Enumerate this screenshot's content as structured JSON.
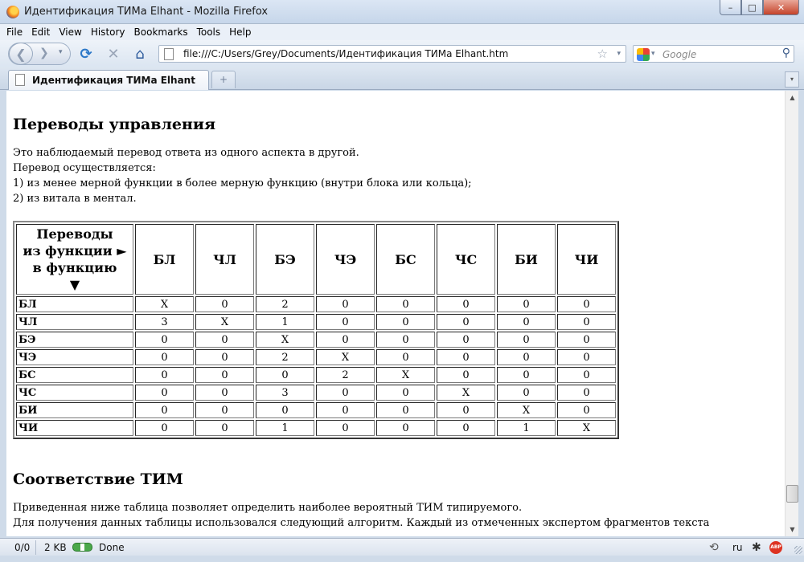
{
  "window": {
    "title": "Идентификация ТИМа Elhant - Mozilla Firefox",
    "minimize_label": "–",
    "maximize_label": "□",
    "close_label": "✕"
  },
  "menu": {
    "items": [
      "File",
      "Edit",
      "View",
      "History",
      "Bookmarks",
      "Tools",
      "Help"
    ]
  },
  "toolbar": {
    "back_glyph": "❮",
    "forward_glyph": "❯",
    "dropdown_glyph": "▾",
    "reload_glyph": "⟳",
    "stop_glyph": "✕",
    "home_glyph": "⌂",
    "url": "file:///C:/Users/Grey/Documents/Идентификация ТИМа Elhant.htm",
    "bookmark_glyph": "☆",
    "search_placeholder": "Google",
    "search_glyph": "⚲"
  },
  "tabs": {
    "active_label": "Идентификация ТИМа Elhant",
    "new_tab_glyph": "+",
    "list_glyph": "▾"
  },
  "page": {
    "heading1": "Переводы управления",
    "intro_lines": [
      "Это наблюдаемый перевод ответа из одного аспекта в другой.",
      "Перевод осуществляется:",
      "1) из менее мерной функции в более мерную функцию (внутри блока или кольца);",
      "2) из витала в ментал."
    ],
    "table": {
      "corner_lines": [
        "Переводы",
        "из функции ►",
        "в функцию",
        "▼"
      ],
      "columns": [
        "БЛ",
        "ЧЛ",
        "БЭ",
        "ЧЭ",
        "БС",
        "ЧС",
        "БИ",
        "ЧИ"
      ],
      "rows": [
        {
          "label": "БЛ",
          "cells": [
            "X",
            "0",
            "2",
            "0",
            "0",
            "0",
            "0",
            "0"
          ]
        },
        {
          "label": "ЧЛ",
          "cells": [
            "3",
            "X",
            "1",
            "0",
            "0",
            "0",
            "0",
            "0"
          ]
        },
        {
          "label": "БЭ",
          "cells": [
            "0",
            "0",
            "X",
            "0",
            "0",
            "0",
            "0",
            "0"
          ]
        },
        {
          "label": "ЧЭ",
          "cells": [
            "0",
            "0",
            "2",
            "X",
            "0",
            "0",
            "0",
            "0"
          ]
        },
        {
          "label": "БС",
          "cells": [
            "0",
            "0",
            "0",
            "2",
            "X",
            "0",
            "0",
            "0"
          ]
        },
        {
          "label": "ЧС",
          "cells": [
            "0",
            "0",
            "3",
            "0",
            "0",
            "X",
            "0",
            "0"
          ]
        },
        {
          "label": "БИ",
          "cells": [
            "0",
            "0",
            "0",
            "0",
            "0",
            "0",
            "X",
            "0"
          ]
        },
        {
          "label": "ЧИ",
          "cells": [
            "0",
            "0",
            "1",
            "0",
            "0",
            "0",
            "1",
            "X"
          ]
        }
      ]
    },
    "heading2": "Соответствие ТИМ",
    "outro_lines": [
      "Приведенная ниже таблица позволяет определить наиболее вероятный ТИМ типируемого.",
      "Для получения данных таблицы использовался следующий алгоритм. Каждый из отмеченных экспертом фрагментов текста"
    ]
  },
  "scrollbar": {
    "up_glyph": "▲",
    "down_glyph": "▼",
    "thumb_fraction": 0.95
  },
  "status": {
    "counter": "0/0",
    "size": "2 KB",
    "text": "Done",
    "locale": "ru",
    "adblock_label": "ABP"
  }
}
